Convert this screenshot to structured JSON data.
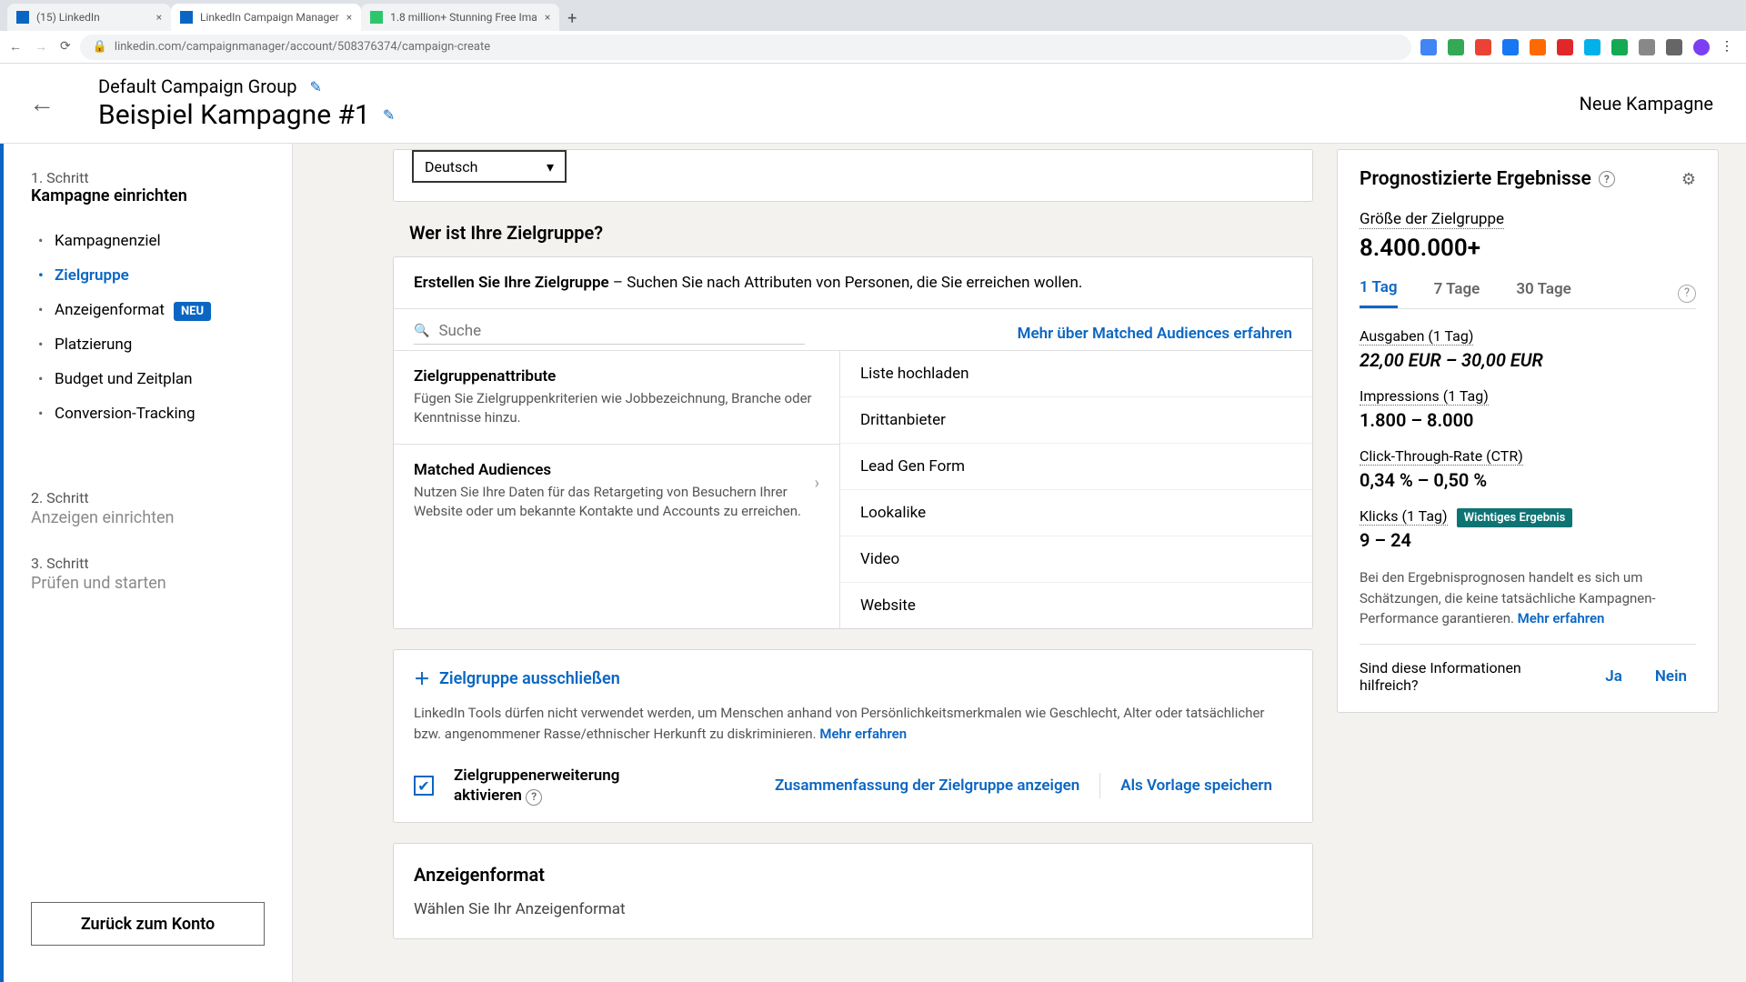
{
  "browser": {
    "tabs": [
      {
        "title": "(15) LinkedIn"
      },
      {
        "title": "LinkedIn Campaign Manager"
      },
      {
        "title": "1.8 million+ Stunning Free Ima"
      }
    ],
    "url": "linkedin.com/campaignmanager/account/508376374/campaign-create"
  },
  "header": {
    "group": "Default Campaign Group",
    "campaign": "Beispiel Kampagne #1",
    "new_label": "Neue Kampagne"
  },
  "sidebar": {
    "step1_label": "1. Schritt",
    "step1_title": "Kampagne einrichten",
    "items": [
      {
        "label": "Kampagnenziel"
      },
      {
        "label": "Zielgruppe"
      },
      {
        "label": "Anzeigenformat",
        "badge": "NEU"
      },
      {
        "label": "Platzierung"
      },
      {
        "label": "Budget und Zeitplan"
      },
      {
        "label": "Conversion-Tracking"
      }
    ],
    "step2_label": "2. Schritt",
    "step2_title": "Anzeigen einrichten",
    "step3_label": "3. Schritt",
    "step3_title": "Prüfen und starten",
    "back_btn": "Zurück zum Konto"
  },
  "content": {
    "language": "Deutsch",
    "audience_q": "Wer ist Ihre Zielgruppe?",
    "aud_top_bold": "Erstellen Sie Ihre Zielgruppe",
    "aud_top_rest": " – Suchen Sie nach Attributen von Personen, die Sie erreichen wollen.",
    "search_placeholder": "Suche",
    "matched_link": "Mehr über Matched Audiences erfahren",
    "left_items": [
      {
        "title": "Zielgruppenattribute",
        "desc": "Fügen Sie Zielgruppenkriterien wie Jobbezeichnung, Branche oder Kenntnisse hinzu."
      },
      {
        "title": "Matched Audiences",
        "desc": "Nutzen Sie Ihre Daten für das Retargeting von Besuchern Ihrer Website oder um bekannte Kontakte und Accounts zu erreichen."
      }
    ],
    "right_items": [
      "Liste hochladen",
      "Drittanbieter",
      "Lead Gen Form",
      "Lookalike",
      "Video",
      "Website"
    ],
    "exclude_btn": "Zielgruppe ausschließen",
    "exclude_note": "LinkedIn Tools dürfen nicht verwendet werden, um Menschen anhand von Persönlichkeitsmerkmalen wie Geschlecht, Alter oder tatsächlicher bzw. angenommener Rasse/ethnischer Herkunft zu diskriminieren. ",
    "exclude_more": "Mehr erfahren",
    "footer_chk_label": "Zielgruppenerweiterung aktivieren",
    "footer_summary": "Zusammenfassung der Zielgruppe anzeigen",
    "footer_save": "Als Vorlage speichern",
    "format_title": "Anzeigenformat",
    "format_sub": "Wählen Sie Ihr Anzeigenformat"
  },
  "forecast": {
    "title": "Prognostizierte Ergebnisse",
    "size_lbl": "Größe der Zielgruppe",
    "size_val": "8.400.000+",
    "tabs": [
      "1 Tag",
      "7 Tage",
      "30 Tage"
    ],
    "metrics": [
      {
        "lbl": "Ausgaben (1 Tag)",
        "val": "22,00 EUR – 30,00 EUR",
        "italic": true
      },
      {
        "lbl": "Impressions (1 Tag)",
        "val": "1.800 – 8.000"
      },
      {
        "lbl": "Click-Through-Rate (CTR)",
        "val": "0,34 % – 0,50 %"
      },
      {
        "lbl": "Klicks (1 Tag)",
        "val": "9 – 24",
        "badge": "Wichtiges Ergebnis"
      }
    ],
    "note": "Bei den Ergebnisprognosen handelt es sich um Schätzungen, die keine tatsächliche Kampagnen-Performance garantieren. ",
    "note_more": "Mehr erfahren",
    "feedback_q": "Sind diese Informationen hilfreich?",
    "yes": "Ja",
    "no": "Nein"
  }
}
